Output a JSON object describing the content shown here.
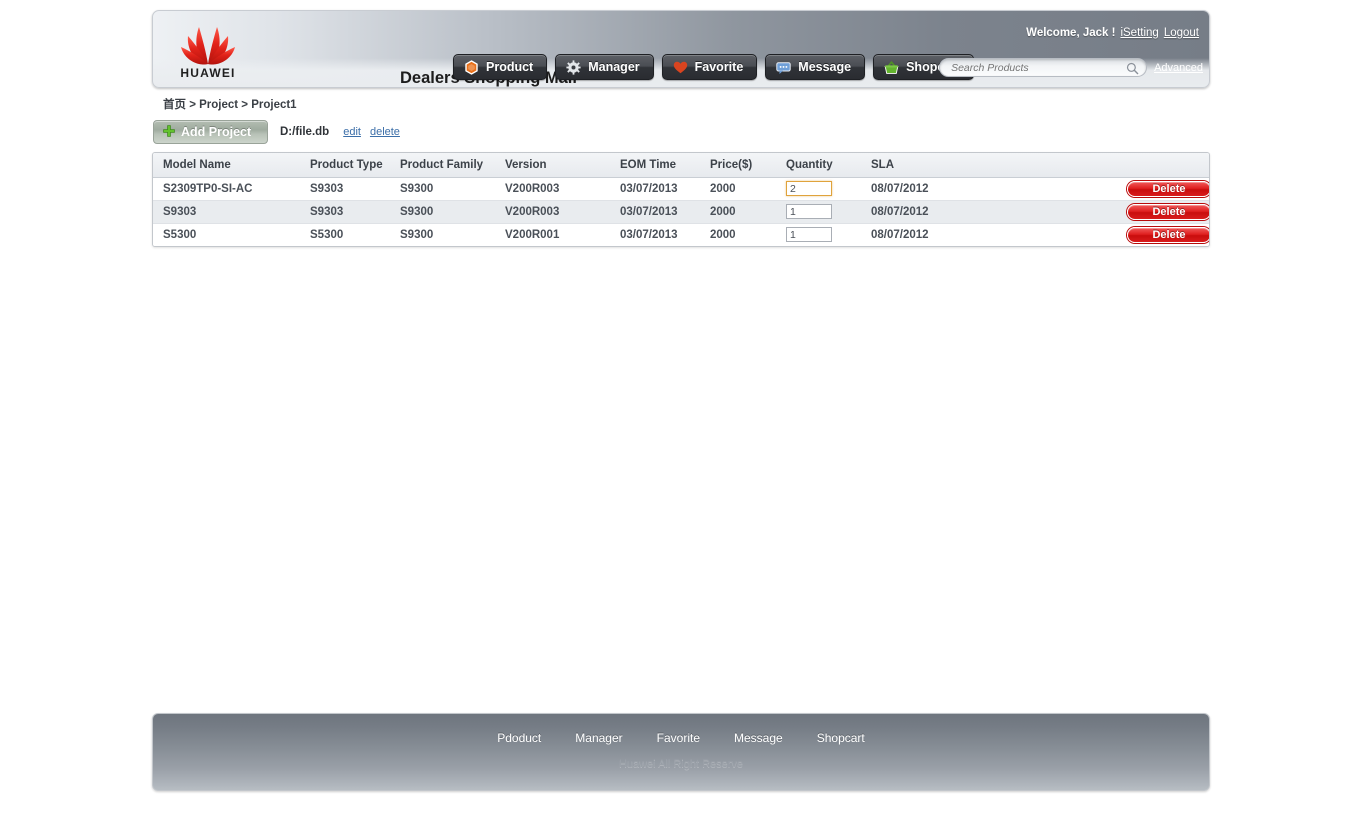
{
  "header": {
    "logo_text": "HUAWEI",
    "brand_title": "Dealers Shopping Mall",
    "welcome_text": "Welcome,  Jack !",
    "isetting_label": "iSetting",
    "logout_label": "Logout",
    "nav": [
      {
        "label": "Product",
        "icon": "hexagon-orange-icon"
      },
      {
        "label": "Manager",
        "icon": "gear-icon"
      },
      {
        "label": "Favorite",
        "icon": "heart-icon"
      },
      {
        "label": "Message",
        "icon": "speech-bubble-icon"
      },
      {
        "label": "Shopcart",
        "icon": "shopping-basket-icon"
      }
    ],
    "search": {
      "placeholder": "Search Products",
      "value": "",
      "icon": "search-icon"
    },
    "advanced_label": "Advanced"
  },
  "breadcrumb": {
    "text": "首页 > Project > Project1"
  },
  "toolbar": {
    "add_project_label": "Add Project",
    "add_icon": "plus-green-icon",
    "file_name": "D:/file.db",
    "edit_label": "edit",
    "delete_label": "delete"
  },
  "table": {
    "columns": [
      "Model Name",
      "Product Type",
      "Product Family",
      "Version",
      "EOM Time",
      "Price($)",
      "Quantity",
      "SLA",
      ""
    ],
    "rows": [
      {
        "model_name": "S2309TP0-SI-AC",
        "product_type": "S9303",
        "product_family": "S9300",
        "version": "V200R003",
        "eom_time": "03/07/2013",
        "price": "2000",
        "quantity": "2",
        "quantity_focused": true,
        "sla": "08/07/2012",
        "delete_label": "Delete"
      },
      {
        "model_name": "S9303",
        "product_type": "S9303",
        "product_family": "S9300",
        "version": "V200R003",
        "eom_time": "03/07/2013",
        "price": "2000",
        "quantity": "1",
        "quantity_focused": false,
        "sla": "08/07/2012",
        "delete_label": "Delete"
      },
      {
        "model_name": "S5300",
        "product_type": "S5300",
        "product_family": "S9300",
        "version": "V200R001",
        "eom_time": "03/07/2013",
        "price": "2000",
        "quantity": "1",
        "quantity_focused": false,
        "sla": "08/07/2012",
        "delete_label": "Delete"
      }
    ]
  },
  "footer": {
    "links": [
      "Pdoduct",
      "Manager",
      "Favorite",
      "Message",
      "Shopcart"
    ],
    "copyright": "Huawei All Right Reserve"
  },
  "colors": {
    "accent_red": "#d81c1c",
    "logo_red": "#e2231a",
    "link_blue": "#3b6ea8",
    "focus_orange": "#e0a33c",
    "header_dark": "#767d87",
    "header_light": "#eef1f4"
  }
}
